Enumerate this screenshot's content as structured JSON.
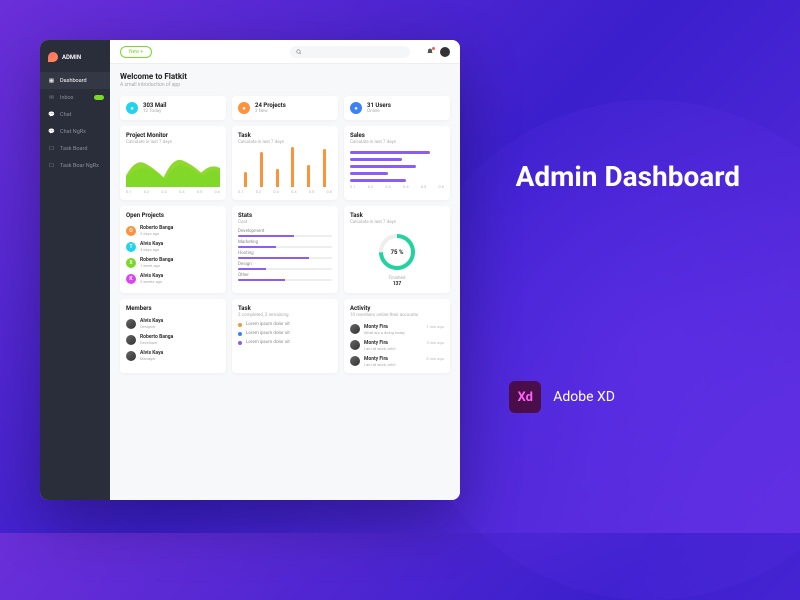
{
  "promo": {
    "title": "Admin Dashboard",
    "tool": "Adobe XD",
    "tool_abbr": "Xd"
  },
  "brand": "ADMIN",
  "nav": [
    {
      "icon": "grid",
      "label": "Dashboard",
      "active": true
    },
    {
      "icon": "mail",
      "label": "Inbox",
      "badge": true
    },
    {
      "icon": "chat",
      "label": "Chat"
    },
    {
      "icon": "chat",
      "label": "Chat NgRx"
    },
    {
      "icon": "board",
      "label": "Task Board"
    },
    {
      "icon": "board",
      "label": "Task Boar NgRx"
    }
  ],
  "topbar": {
    "new_label": "New +"
  },
  "welcome": {
    "title": "Welcome to Flatkit",
    "subtitle": "A small introduction of app"
  },
  "stats": [
    {
      "icon_color": "cyan",
      "value": "303 Mail",
      "sub": "12 Today"
    },
    {
      "icon_color": "orange",
      "value": "24 Projects",
      "sub": "3 New"
    },
    {
      "icon_color": "blue",
      "value": "31 Users",
      "sub": "Online"
    }
  ],
  "chart_data": [
    {
      "type": "area",
      "title": "Project Monitor",
      "subtitle": "Calculate in last 7 days",
      "x": [
        0.1,
        0.2,
        0.3,
        0.4,
        0.5,
        0.6
      ],
      "values": [
        30,
        65,
        25,
        70,
        35,
        55
      ],
      "fill": "#8FD82F"
    },
    {
      "type": "bar",
      "title": "Task",
      "subtitle": "Calculate in last 7 days",
      "categories": [
        0.1,
        0.2,
        0.3,
        0.4,
        0.5,
        0.6
      ],
      "values": [
        15,
        35,
        18,
        40,
        22,
        38
      ],
      "color": "#FB923C"
    },
    {
      "type": "bar-h",
      "title": "Sales",
      "subtitle": "Calculate in last 7 days",
      "values": [
        85,
        55,
        70,
        40,
        60
      ],
      "color": "#8B5CF6"
    },
    {
      "type": "donut",
      "title": "Task",
      "subtitle": "Calculate in last 7 days",
      "value": 75,
      "label": "75 %",
      "color": "#22D3A0",
      "finished_label": "Finished",
      "finished_value": "137"
    }
  ],
  "open_projects": {
    "title": "Open Projects",
    "items": [
      {
        "letter": "O",
        "color": "#FB923C",
        "name": "Roberto Banga",
        "meta": "2 days ago"
      },
      {
        "letter": "T",
        "color": "#22D3EE",
        "name": "Alvis Kaya",
        "meta": "4 days ago"
      },
      {
        "letter": "X",
        "color": "#7CD827",
        "name": "Roberto Banga",
        "meta": "1 week ago"
      },
      {
        "letter": "K",
        "color": "#D946EF",
        "name": "Alvis Kaya",
        "meta": "2 weeks ago"
      }
    ]
  },
  "stats_block": {
    "title": "Stats",
    "sub": "Cost",
    "items": [
      {
        "label": "Development",
        "val": 60
      },
      {
        "label": "Marketing",
        "val": 40
      },
      {
        "label": "Hosting",
        "val": 75
      },
      {
        "label": "Design",
        "val": 30
      },
      {
        "label": "Other",
        "val": 50
      }
    ]
  },
  "members": {
    "title": "Members",
    "items": [
      {
        "name": "Alvis Kaya",
        "meta": "Designer"
      },
      {
        "name": "Roberto Banga",
        "meta": "Developer"
      },
      {
        "name": "Alvis Kaya",
        "meta": "Manager"
      }
    ]
  },
  "tasks_block": {
    "title": "Task",
    "sub": "2 completed, 2 remaining",
    "items": [
      {
        "color": "#FB923C",
        "text": "Lorem ipsum dolor sit"
      },
      {
        "color": "#3B82F6",
        "text": "Lorem ipsum dolor sit"
      },
      {
        "color": "#8B5CF6",
        "text": "Lorem ipsum dolor sit"
      }
    ]
  },
  "activity": {
    "title": "Activity",
    "sub": "10 members online their accounts",
    "items": [
      {
        "name": "Monty Fira",
        "meta": "What are u doing today",
        "time": "1 min ago"
      },
      {
        "name": "Monty Fira",
        "meta": "I am at work, brb!!",
        "time": "5 min ago"
      },
      {
        "name": "Monty Fira",
        "meta": "I am at work, brb!!",
        "time": "8 min ago"
      }
    ]
  }
}
